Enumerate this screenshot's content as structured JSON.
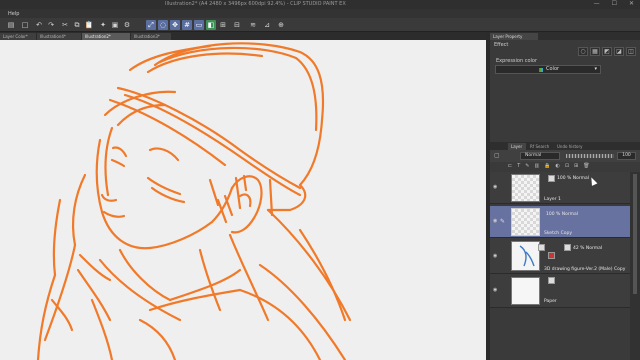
{
  "window": {
    "title": "Illustration2* (A4 2480 x 3496px 600dpi 92.4%)  - CLIP STUDIO PAINT EX",
    "controls": [
      "—",
      "☐",
      "✕"
    ]
  },
  "menu": {
    "help": "Help"
  },
  "toolbar": {
    "icons": [
      "layers-icon",
      "undo-icon",
      "redo-icon",
      "cut-icon",
      "copy-icon",
      "paste-icon",
      "transform-icon",
      "fill-icon",
      "settings-icon",
      "select-icon",
      "lasso-icon",
      "move-icon",
      "grid-icon",
      "ruler-icon",
      "color-icon",
      "palette-icon",
      "snap-icon",
      "snap2-icon",
      "lock-icon"
    ]
  },
  "doc_tabs": [
    {
      "label": "Layer Color*",
      "active": false
    },
    {
      "label": "Illustration4*",
      "active": false
    },
    {
      "label": "Illustration2*",
      "active": true
    },
    {
      "label": "Illustration3*",
      "active": false
    }
  ],
  "panel": {
    "top_tab": "Layer Property",
    "effect_label": "Effect",
    "expression_color_label": "Expression color",
    "expression_color_value": "Color",
    "layer_tabs": [
      "Layer",
      "Rf Search",
      "Undo history"
    ],
    "blend_mode": "Normal",
    "opacity": "100",
    "layers": [
      {
        "mode": "100 % Normal",
        "name": "Layer 1",
        "selected": false
      },
      {
        "mode": "100 % Normal",
        "name": "Sketch Copy",
        "selected": true
      },
      {
        "mode": "42 % Normal",
        "name": "3D drawing figure-Ver.2 (Male) Copy",
        "selected": false
      },
      {
        "mode": "",
        "name": "Paper",
        "selected": false
      }
    ]
  },
  "colors": {
    "stroke": "#f07a2a",
    "canvas": "#efefef",
    "accent": "#6872a0"
  }
}
